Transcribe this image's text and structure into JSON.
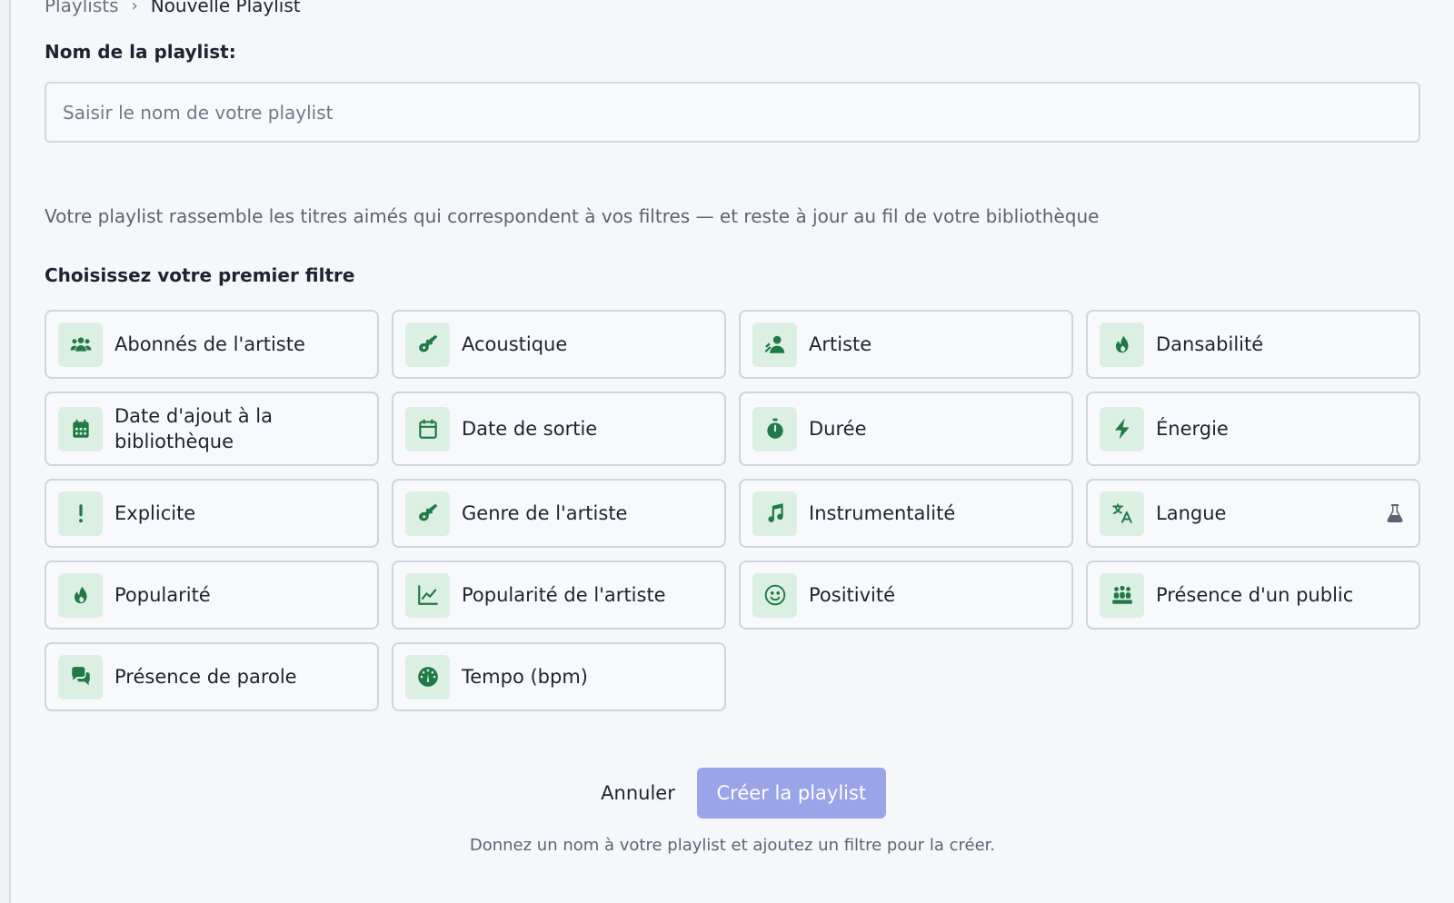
{
  "breadcrumb": {
    "parent": "Playlists",
    "separator": "›",
    "current": "Nouvelle Playlist"
  },
  "form": {
    "name_label": "Nom de la playlist:",
    "name_placeholder": "Saisir le nom de votre playlist",
    "name_value": "",
    "description": "Votre playlist rassemble les titres aimés qui correspondent à vos filtres — et reste à jour au fil de votre bibliothèque",
    "section_title": "Choisissez votre premier filtre"
  },
  "filters": [
    {
      "label": "Abonnés de l'artiste",
      "icon": "users-icon"
    },
    {
      "label": "Acoustique",
      "icon": "guitar-icon"
    },
    {
      "label": "Artiste",
      "icon": "artist-icon"
    },
    {
      "label": "Dansabilité",
      "icon": "flame-icon"
    },
    {
      "label": "Date d'ajout à la bibliothèque",
      "icon": "calendar-filled-icon"
    },
    {
      "label": "Date de sortie",
      "icon": "calendar-outline-icon"
    },
    {
      "label": "Durée",
      "icon": "stopwatch-icon"
    },
    {
      "label": "Énergie",
      "icon": "bolt-icon"
    },
    {
      "label": "Explicite",
      "icon": "exclamation-icon"
    },
    {
      "label": "Genre de l'artiste",
      "icon": "guitar-icon"
    },
    {
      "label": "Instrumentalité",
      "icon": "music-note-icon"
    },
    {
      "label": "Langue",
      "icon": "translate-icon",
      "beta_icon": "flask-icon"
    },
    {
      "label": "Popularité",
      "icon": "flame-icon"
    },
    {
      "label": "Popularité de l'artiste",
      "icon": "chart-line-icon"
    },
    {
      "label": "Positivité",
      "icon": "smile-icon"
    },
    {
      "label": "Présence d'un public",
      "icon": "audience-icon"
    },
    {
      "label": "Présence de parole",
      "icon": "speech-bubbles-icon"
    },
    {
      "label": "Tempo (bpm)",
      "icon": "gauge-icon"
    }
  ],
  "actions": {
    "cancel_label": "Annuler",
    "create_label": "Créer la playlist",
    "hint": "Donnez un nom à votre playlist et ajoutez un filtre pour la créer."
  },
  "colors": {
    "accent_green": "#1f7a45",
    "icon_bg": "#dcefe3",
    "primary_disabled": "#9aa4e8",
    "background": "#f6f7fb"
  }
}
